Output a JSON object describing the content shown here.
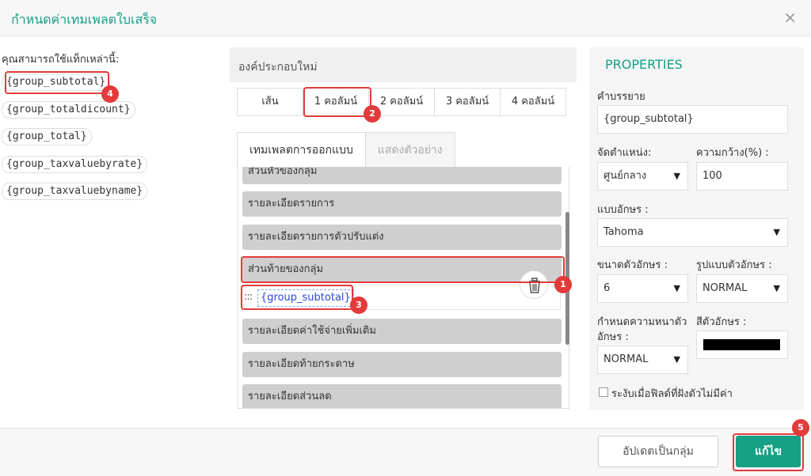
{
  "dialog": {
    "title": "กำหนดค่าเทมเพลตใบเสร็จ",
    "close_glyph": "×"
  },
  "tags": {
    "hint": "คุณสามารถใช้แท็กเหล่านี้:",
    "items": [
      "{group_subtotal}",
      "{group_totaldicount}",
      "{group_total}",
      "{group_taxvaluebyrate}",
      "{group_taxvaluebyname}"
    ]
  },
  "components": {
    "header": "องค์ประกอบใหม่",
    "column_tabs": [
      "เส้น",
      "1 คอลัมน์",
      "2 คอลัมน์",
      "3 คอลัมน์",
      "4 คอลัมน์"
    ]
  },
  "design": {
    "tabs": [
      "เทมเพลตการออกแบบ",
      "แสดงตัวอย่าง"
    ],
    "sections": [
      "ส่วนหัวของกลุ่ม",
      "รายละเอียดรายการ",
      "รายละเอียดรายการตัวปรับแต่ง",
      "ส่วนท้ายของกลุ่ม",
      "รายละเอียดค่าใช้จ่ายเพิ่มเติม",
      "รายละเอียดท้ายกระดาษ",
      "รายละเอียดส่วนลด"
    ],
    "handle": ":::",
    "field_chip": "{group_subtotal}"
  },
  "properties": {
    "title": "PROPERTIES",
    "description_label": "คำบรรยาย",
    "description_value": "{group_subtotal}",
    "align_label": "จัดตำแหน่ง:",
    "align_value": "ศูนย์กลาง",
    "width_label": "ความกว้าง(%) :",
    "width_value": "100",
    "font_label": "แบบอักษร :",
    "font_value": "Tahoma",
    "size_label": "ขนาดตัวอักษร :",
    "size_value": "6",
    "style_label": "รูปแบบตัวอักษร :",
    "style_value": "NORMAL",
    "weight_label_1": "กำหนดความหนาตัว",
    "weight_label_2": "อักษร :",
    "weight_value": "NORMAL",
    "color_label": "สีตัวอักษร :",
    "color_value": "#000000",
    "hide_empty_label": "ระงับเมื่อฟิลด์ที่ฝังตัวไม่มีค่า",
    "caret": "▼"
  },
  "footer": {
    "update_group": "อัปเดตเป็นกลุ่ม",
    "edit": "แก้ไข"
  },
  "annotations": [
    "1",
    "2",
    "3",
    "4",
    "5"
  ],
  "colors": {
    "accent": "#16a085",
    "annotation": "#e33b3b"
  }
}
